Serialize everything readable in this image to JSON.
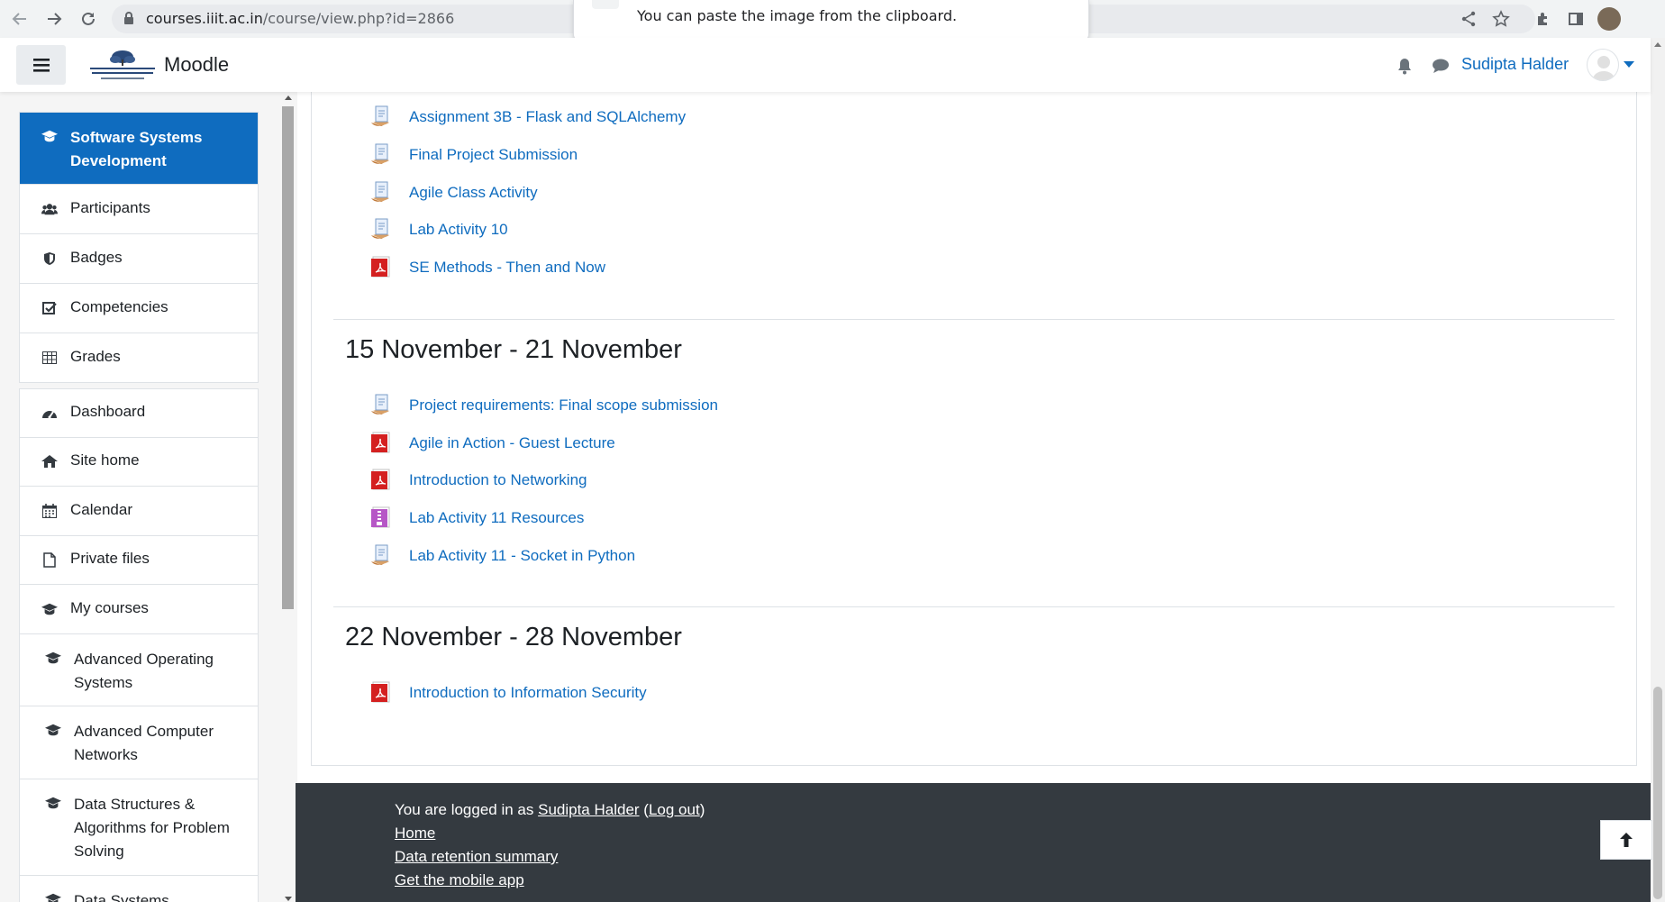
{
  "browser": {
    "url_host": "courses.iiit.ac.in",
    "url_path": "/course/view.php?id=2866",
    "toast_text": "You can paste the image from the clipboard."
  },
  "header": {
    "site_name": "Moodle",
    "user_name": "Sudipta Halder"
  },
  "drawer": {
    "course": {
      "label": "Software Systems Development",
      "icon": "graduation-cap-icon"
    },
    "course_nav": [
      {
        "label": "Participants",
        "icon": "users-icon"
      },
      {
        "label": "Badges",
        "icon": "shield-icon"
      },
      {
        "label": "Competencies",
        "icon": "check-square-icon"
      },
      {
        "label": "Grades",
        "icon": "table-icon"
      }
    ],
    "site_nav": [
      {
        "label": "Dashboard",
        "icon": "dashboard-icon"
      },
      {
        "label": "Site home",
        "icon": "home-icon"
      },
      {
        "label": "Calendar",
        "icon": "calendar-icon"
      },
      {
        "label": "Private files",
        "icon": "file-icon"
      },
      {
        "label": "My courses",
        "icon": "graduation-cap-icon"
      }
    ],
    "courses": [
      {
        "label": "Advanced Operating Systems"
      },
      {
        "label": "Advanced Computer Networks"
      },
      {
        "label": "Data Structures & Algorithms for Problem Solving"
      },
      {
        "label": "Data Systems"
      }
    ]
  },
  "sections": [
    {
      "title": "",
      "activities": [
        {
          "label": "Assignment 3B - Flask and SQLAlchemy",
          "icon": "assignment-icon"
        },
        {
          "label": "Final Project Submission",
          "icon": "assignment-icon"
        },
        {
          "label": "Agile Class Activity",
          "icon": "assignment-icon"
        },
        {
          "label": "Lab Activity 10",
          "icon": "assignment-icon"
        },
        {
          "label": "SE Methods - Then and Now",
          "icon": "pdf-icon"
        }
      ]
    },
    {
      "title": "15 November - 21 November",
      "activities": [
        {
          "label": "Project requirements: Final scope submission",
          "icon": "assignment-icon"
        },
        {
          "label": "Agile in Action - Guest Lecture",
          "icon": "pdf-icon"
        },
        {
          "label": "Introduction to Networking",
          "icon": "pdf-icon"
        },
        {
          "label": "Lab Activity 11 Resources",
          "icon": "archive-icon"
        },
        {
          "label": "Lab Activity 11 - Socket in Python",
          "icon": "assignment-icon"
        }
      ]
    },
    {
      "title": "22 November - 28 November",
      "activities": [
        {
          "label": "Introduction to Information Security",
          "icon": "pdf-icon"
        }
      ]
    }
  ],
  "footer": {
    "logged_in_prefix": "You are logged in as ",
    "user_link": "Sudipta Halder",
    "logout_open": " (",
    "logout_link": "Log out",
    "logout_close": ")",
    "links": [
      "Home",
      "Data retention summary",
      "Get the mobile app"
    ]
  },
  "colors": {
    "brand": "#0f6cbf",
    "footer_bg": "#343a40",
    "drawer_bg": "#f5f5f5"
  }
}
